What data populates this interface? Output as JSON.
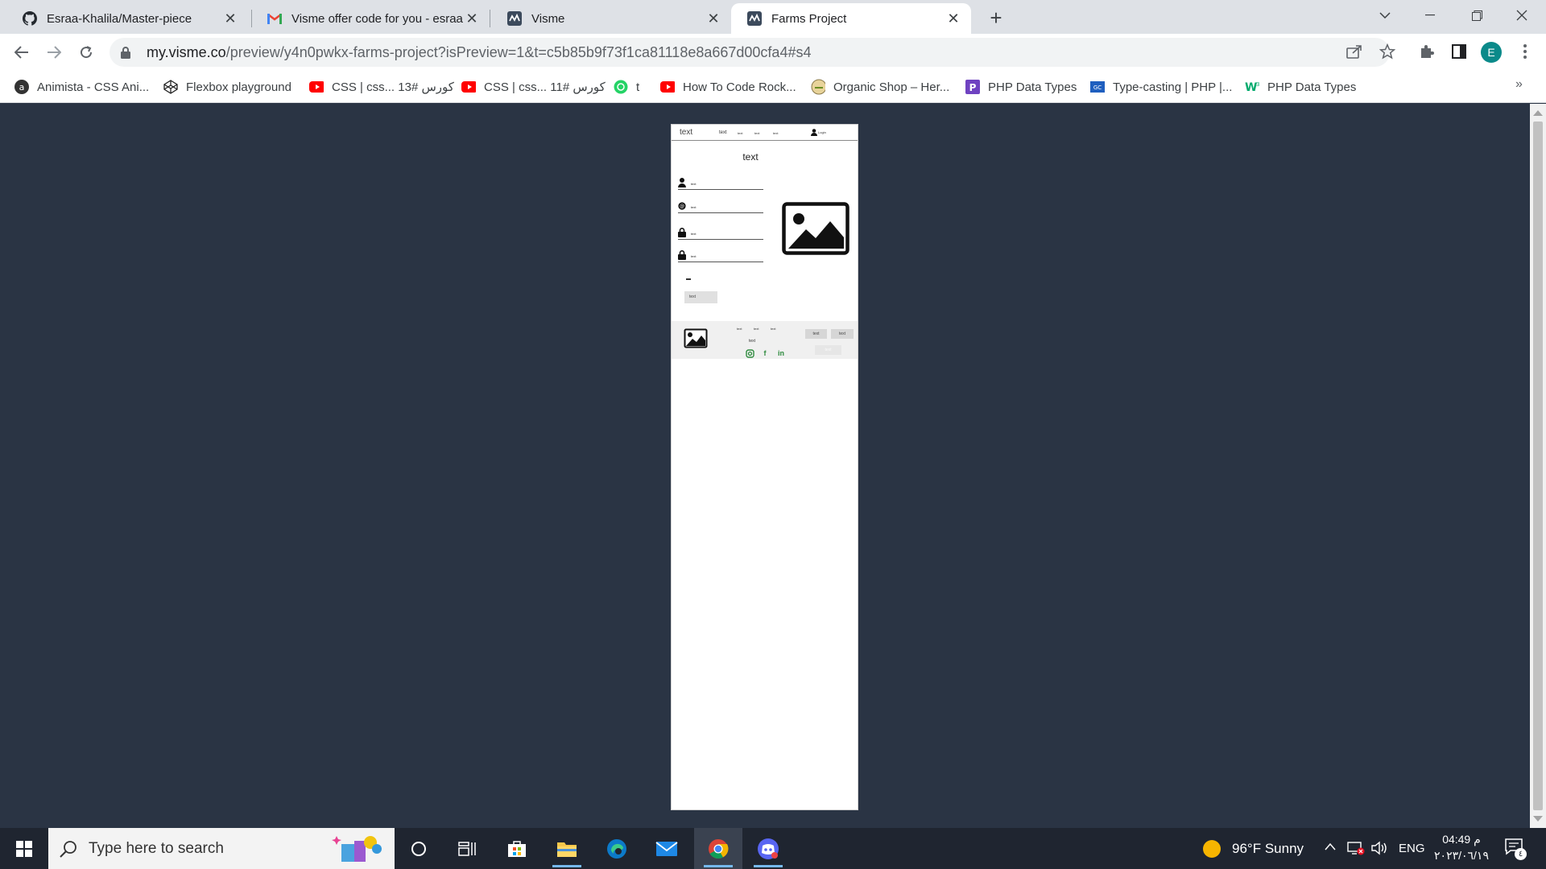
{
  "browser": {
    "tabs": [
      {
        "title": "Esraa-Khalila/Master-piece",
        "icon": "github-icon",
        "active": false
      },
      {
        "title": "Visme offer code for you - esraa.k",
        "icon": "gmail-icon",
        "active": false
      },
      {
        "title": "Visme",
        "icon": "visme-icon",
        "active": false
      },
      {
        "title": "Farms Project",
        "icon": "visme-icon",
        "active": true
      }
    ],
    "url_host": "my.visme.co",
    "url_path": "/preview/y4n0pwkx-farms-project?isPreview=1&t=c5b85b9f73f1ca81118e8a667d00cfa4#s4",
    "profile_initial": "E",
    "bookmarks": [
      {
        "label": "Animista - CSS Ani...",
        "icon": "animista-icon"
      },
      {
        "label": "Flexbox playground",
        "icon": "codepen-icon"
      },
      {
        "label": "CSS | css... كورس #13",
        "icon": "youtube-icon"
      },
      {
        "label": "CSS | css... كورس #11",
        "icon": "youtube-icon"
      },
      {
        "label": "t",
        "icon": "whatsapp-icon"
      },
      {
        "label": "How To Code Rock...",
        "icon": "youtube-icon"
      },
      {
        "label": "Organic Shop – Her...",
        "icon": "organic-shop-icon"
      },
      {
        "label": "PHP Data Types",
        "icon": "php-icon"
      },
      {
        "label": "Type-casting | PHP |...",
        "icon": "gc-icon"
      },
      {
        "label": "PHP Data Types",
        "icon": "w3schools-icon"
      }
    ],
    "bookmarks_more": "»"
  },
  "preview": {
    "nav": {
      "brand": "text",
      "links": [
        "text",
        "text",
        "text",
        "text"
      ],
      "login": "Login"
    },
    "form": {
      "title": "text",
      "fields": [
        {
          "label": "text",
          "icon": "user-icon"
        },
        {
          "label": "text",
          "icon": "email-icon"
        },
        {
          "label": "text",
          "icon": "lock-icon"
        },
        {
          "label": "text",
          "icon": "lock-icon"
        }
      ],
      "submit_label": "text"
    },
    "footer": {
      "links": [
        "text",
        "text",
        "text"
      ],
      "caption": "text",
      "social": [
        "instagram-icon",
        "facebook-icon",
        "linkedin-icon"
      ],
      "buttons": [
        "text",
        "text",
        "text"
      ]
    }
  },
  "taskbar": {
    "search_placeholder": "Type here to search",
    "weather": "96°F  Sunny",
    "language": "ENG",
    "time": "04:49 م",
    "date": "٢٠٢٣/٠٦/١٩",
    "notifications_count": "٤"
  },
  "colors": {
    "desktop_bg": "#2a3444",
    "social_green": "#2e8b3e",
    "taskbar_bg": "#1f2530"
  }
}
